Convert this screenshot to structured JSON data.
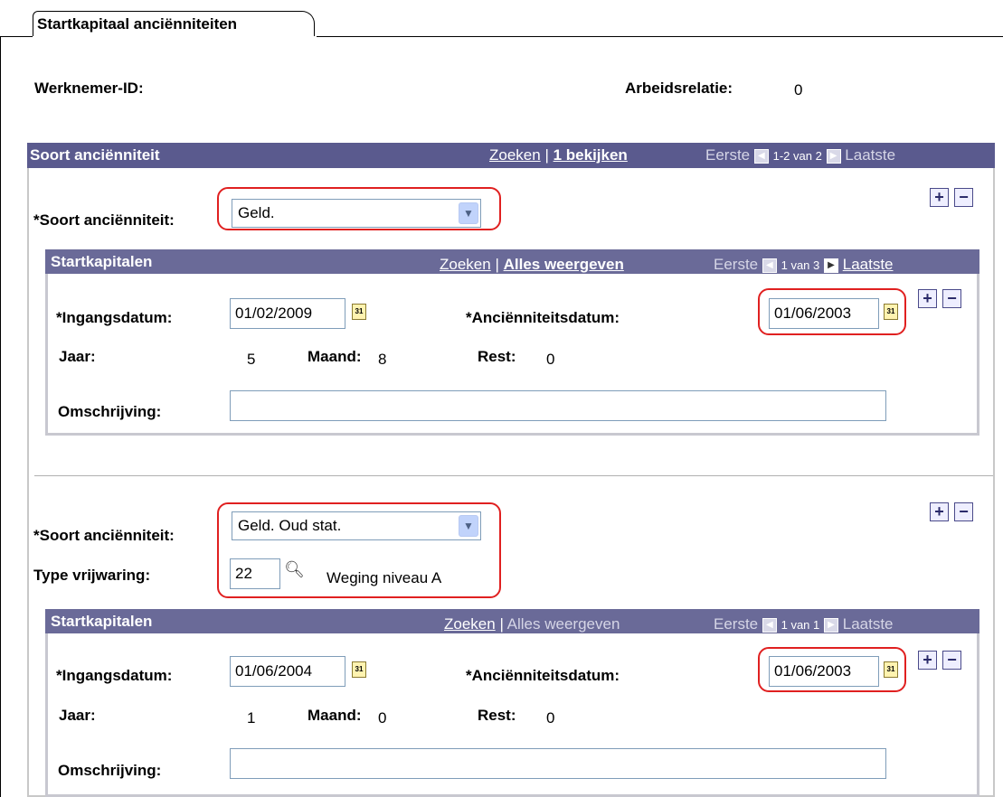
{
  "tab": {
    "label": "Startkapitaal anciënniteiten"
  },
  "header": {
    "employee_label": "Werknemer-ID:",
    "employee_value": "",
    "relation_label": "Arbeidsrelatie:",
    "relation_value": "0"
  },
  "outer": {
    "title": "Soort anciënniteit",
    "find": "Zoeken",
    "sep": "|",
    "view": "1 bekijken",
    "first": "Eerste",
    "range": "1-2 van 2",
    "last": "Laatste"
  },
  "entry1": {
    "type_label": "*Soort anciënniteit:",
    "type_value": "Geld.",
    "inner": {
      "title": "Startkapitalen",
      "find": "Zoeken",
      "sep": "|",
      "view_all": "Alles weergeven",
      "first": "Eerste",
      "range": "1 van 3",
      "last": "Laatste"
    },
    "start_label": "*Ingangsdatum:",
    "start_value": "01/02/2009",
    "seniority_label": "*Anciënniteitsdatum:",
    "seniority_value": "01/06/2003",
    "year_label": "Jaar:",
    "year_value": "5",
    "month_label": "Maand:",
    "month_value": "8",
    "rest_label": "Rest:",
    "rest_value": "0",
    "desc_label": "Omschrijving:",
    "desc_value": ""
  },
  "entry2": {
    "type_label": "*Soort anciënniteit:",
    "type_value": "Geld. Oud stat.",
    "indemnity_label": "Type vrijwaring:",
    "indemnity_value": "22",
    "indemnity_desc": "Weging niveau A",
    "inner": {
      "title": "Startkapitalen",
      "find": "Zoeken",
      "sep": "|",
      "view_all": "Alles weergeven",
      "first": "Eerste",
      "range": "1 van 1",
      "last": "Laatste"
    },
    "start_label": "*Ingangsdatum:",
    "start_value": "01/06/2004",
    "seniority_label": "*Anciënniteitsdatum:",
    "seniority_value": "01/06/2003",
    "year_label": "Jaar:",
    "year_value": "1",
    "month_label": "Maand:",
    "month_value": "0",
    "rest_label": "Rest:",
    "rest_value": "0",
    "desc_label": "Omschrijving:",
    "desc_value": ""
  },
  "icons": {
    "calendar": "31",
    "add": "+",
    "remove": "−",
    "dropdown": "chevron-down-icon",
    "lookup": "search-icon",
    "prev": "◀",
    "next": "▶"
  },
  "colors": {
    "header_bar": "#5a5a8e",
    "sub_bar": "#6a6a98",
    "highlight": "#e02020"
  }
}
